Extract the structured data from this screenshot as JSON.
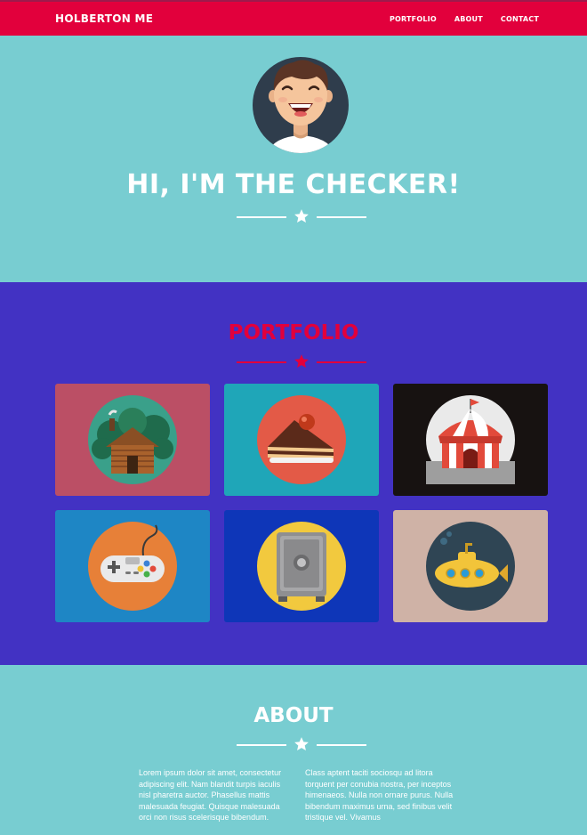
{
  "nav": {
    "brand": "HOLBERTON ME",
    "links": [
      "PORTFOLIO",
      "ABOUT",
      "CONTACT"
    ]
  },
  "hero": {
    "title": "HI, I'M THE CHECKER!",
    "avatar_icon": "smiling-person-avatar-icon"
  },
  "portfolio": {
    "title": "PORTFOLIO",
    "items": [
      {
        "icon": "log-cabin-icon",
        "bg": "#bb4f65"
      },
      {
        "icon": "cake-slice-icon",
        "bg": "#1fa6b8"
      },
      {
        "icon": "circus-tent-icon",
        "bg": "#171211"
      },
      {
        "icon": "game-controller-icon",
        "bg": "#1e86c5"
      },
      {
        "icon": "safe-icon",
        "bg": "#0e36b8"
      },
      {
        "icon": "submarine-icon",
        "bg": "#cfb2a6"
      }
    ]
  },
  "about": {
    "title": "ABOUT",
    "col1": "Lorem ipsum dolor sit amet, consectetur adipiscing elit. Nam blandit turpis iaculis nisl pharetra auctor. Phasellus mattis malesuada feugiat. Quisque malesuada orci non risus scelerisque bibendum.",
    "col2": "Class aptent taciti sociosqu ad litora torquent per conubia nostra, per inceptos himenaeos. Nulla non ornare purus. Nulla bibendum maximus urna, sed finibus velit tristique vel. Vivamus"
  },
  "colors": {
    "accent": "#e2003c",
    "hero_bg": "#78cdd1",
    "portfolio_bg": "#4232c3",
    "white": "#ffffff"
  }
}
